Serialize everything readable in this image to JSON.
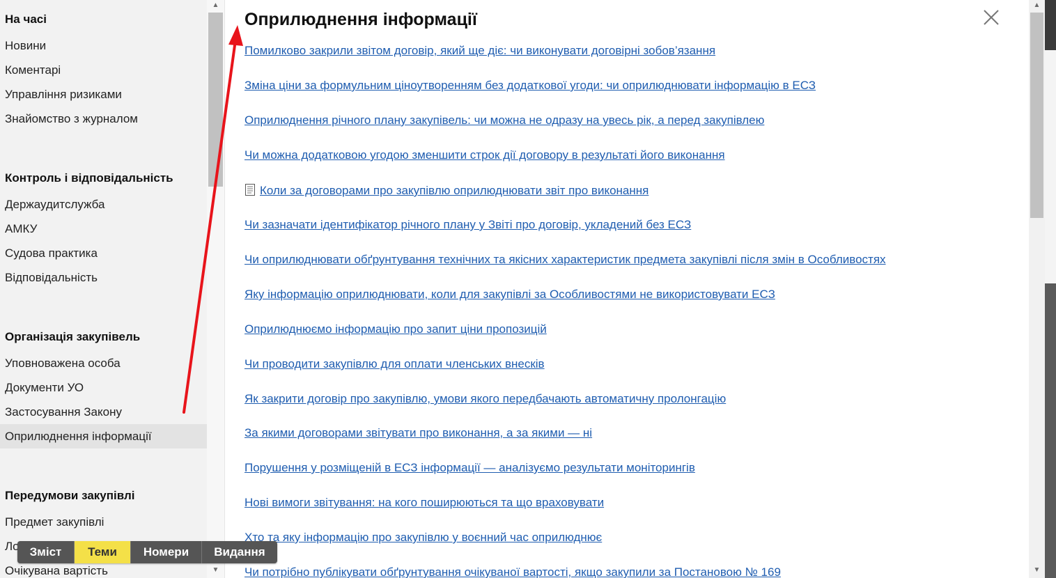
{
  "sidebar": {
    "sections": [
      {
        "title": "На часі",
        "items": [
          "Новини",
          "Коментарі",
          "Управління ризиками",
          "Знайомство з журналом"
        ]
      },
      {
        "title": "Контроль і відповідальність",
        "items": [
          "Держаудитслужба",
          "АМКУ",
          "Судова практика",
          "Відповідальність"
        ]
      },
      {
        "title": "Організація закупівель",
        "items": [
          "Уповноважена особа",
          "Документи УО",
          "Застосування Закону",
          "Оприлюднення інформації"
        ]
      },
      {
        "title": "Передумови закупівлі",
        "items": [
          "Предмет закупівлі",
          "Лот закупівлі",
          "Очікувана вартість"
        ]
      }
    ],
    "active_item": "Оприлюднення інформації"
  },
  "main": {
    "title": "Оприлюднення інформації",
    "articles": [
      "Помилково закрили звітом договір, який ще діє: чи виконувати договірні зобов’язання",
      "Зміна ціни за формульним ціноутворенням без додаткової угоди: чи оприлюднювати інформацію в ЕСЗ",
      "Оприлюднення річного плану закупівель: чи можна не одразу на увесь рік, а перед закупівлею",
      "Чи можна додатковою угодою зменшити строк дії договору в результаті його виконання",
      "Коли за договорами про закупівлю оприлюднювати звіт про виконання",
      "Чи зазначати ідентифікатор річного плану у Звіті про договір, укладений без ЕСЗ",
      "Чи оприлюднювати обґрунтування технічних та якісних характеристик предмета закупівлі після змін в Особливостях",
      "Яку інформацію оприлюднювати, коли для закупівлі за Особливостями не використовувати ЕСЗ",
      "Оприлюднюємо інформацію про запит ціни пропозицій",
      "Чи проводити закупівлю для оплати членських внесків",
      "Як закрити договір про закупівлю, умови якого передбачають автоматичну пролонгацію",
      "За якими договорами звітувати про виконання, а за якими — ні",
      "Порушення у розміщеній в ЕСЗ інформації — аналізуємо результати моніторингів",
      "Нові вимоги звітування: на кого поширюються та що враховувати",
      "Хто та яку інформацію про закупівлю у воєнний час оприлюднює",
      "Чи потрібно публікувати обґрунтування очікуваної вартості, якщо закупили за Постановою № 169"
    ],
    "doc_icon_article_index": 4
  },
  "tabs": [
    {
      "label": "Зміст",
      "active": false
    },
    {
      "label": "Теми",
      "active": true
    },
    {
      "label": "Номери",
      "active": false
    },
    {
      "label": "Видання",
      "active": false
    }
  ],
  "colors": {
    "link": "#1f5db0",
    "active_tab": "#f4e048",
    "annotation_arrow": "#e8141b"
  },
  "icons": {
    "close": "close-icon",
    "doc": "document-icon",
    "scroll_up": "chevron-up-icon",
    "scroll_down": "chevron-down-icon"
  }
}
